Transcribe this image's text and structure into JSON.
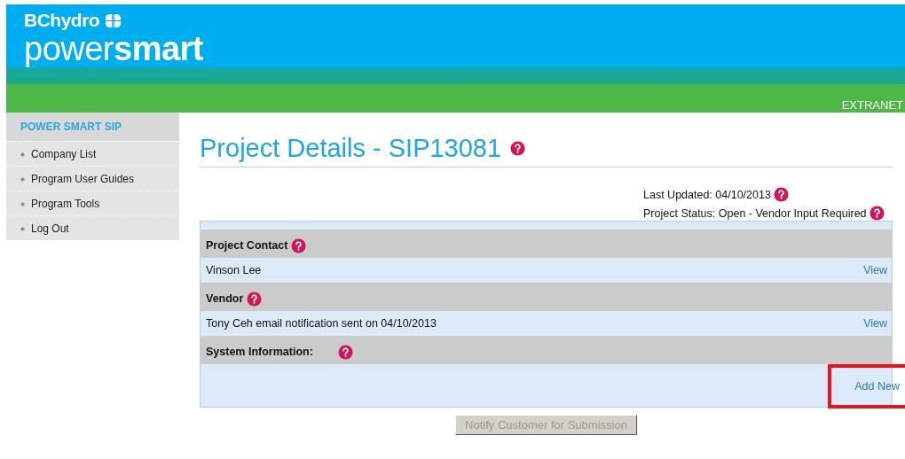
{
  "header": {
    "brand": "BChydro",
    "product_light": "power",
    "product_bold": "smart",
    "band_label": "EXTRANET"
  },
  "sidebar": {
    "title": "POWER SMART SIP",
    "items": [
      {
        "label": "Company List"
      },
      {
        "label": "Program User Guides"
      },
      {
        "label": "Program Tools"
      },
      {
        "label": "Log Out"
      }
    ]
  },
  "page": {
    "title": "Project Details - SIP13081",
    "meta": [
      "Last Updated: 04/10/2013",
      "Project Status: Open - Vendor Input Required"
    ],
    "sections": [
      {
        "heading": "Project Contact",
        "rows": [
          {
            "text": "Vinson Lee",
            "link": "View",
            "highlighted": false
          }
        ]
      },
      {
        "heading": "Vendor",
        "rows": [
          {
            "text": "Tony Ceh email notification sent on 04/10/2013",
            "link": "View",
            "highlighted": false
          }
        ]
      },
      {
        "heading": "System Information:",
        "rows": [
          {
            "link": "Add New",
            "highlighted": true
          }
        ]
      }
    ]
  },
  "notify_button": {
    "label": "Notify Customer for Submission",
    "disabled": true
  }
}
